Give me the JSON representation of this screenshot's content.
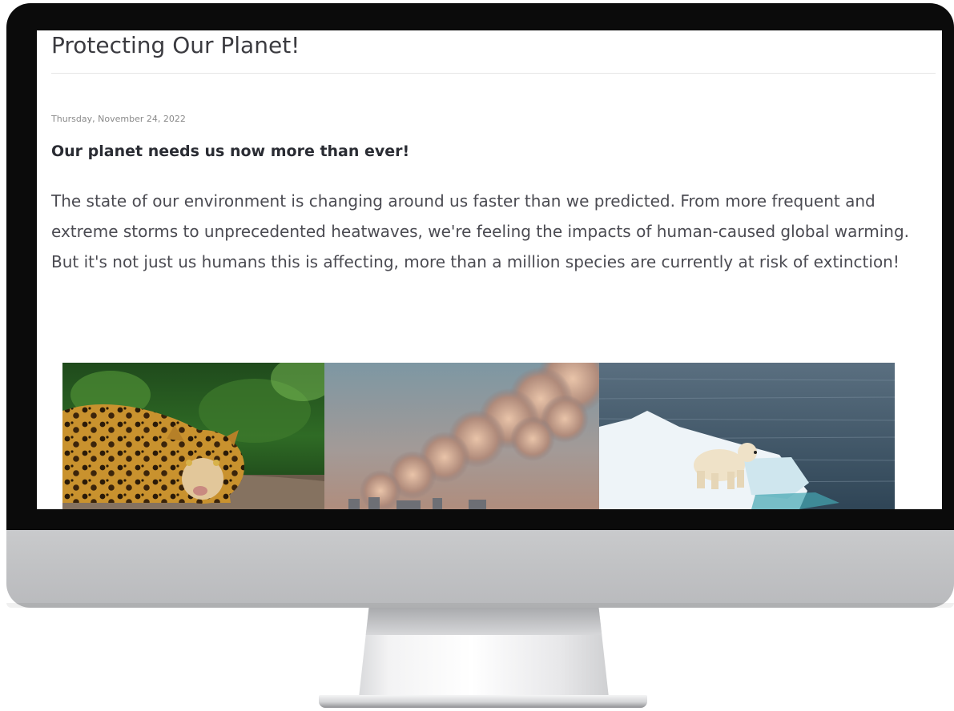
{
  "post": {
    "blog_title": "Protecting Our Planet!",
    "date": "Thursday, November 24, 2022",
    "heading": "Our planet needs us now more than ever!",
    "body": "The state of our environment is changing around us faster than we predicted. From more frequent and extreme storms to unprecedented heatwaves, we're feeling the impacts of human-caused global warming. But it's not just us humans this is affecting, more than a million species are currently at risk of extinction!"
  },
  "images": [
    {
      "icon": "jaguar-photo"
    },
    {
      "icon": "smokestack-photo"
    },
    {
      "icon": "polar-bear-photo"
    }
  ],
  "colors": {
    "bezel": "#0b0b0b",
    "title_text": "#3b3b40",
    "body_text": "#4b4b52",
    "heading_text": "#2a2c33",
    "date_text": "#8a8a8a"
  }
}
